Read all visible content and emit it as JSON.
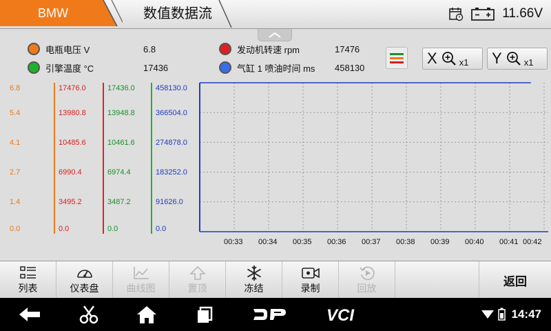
{
  "header": {
    "brand": "BMW",
    "title": "数值数据流",
    "voltage": "11.66V",
    "colors": {
      "brand_tab": "#f07a1a"
    }
  },
  "legend": [
    {
      "label": "电瓶电压  V",
      "value": "6.8",
      "color": "#f07a1a"
    },
    {
      "label": "引擎温度  °C",
      "value": "17436",
      "color": "#21b02a"
    },
    {
      "label": "发动机转速  rpm",
      "value": "17476",
      "color": "#e02020"
    },
    {
      "label": "气缸 1 喷油时间  ms",
      "value": "458130",
      "color": "#3a6de8"
    }
  ],
  "zoom": {
    "x_axis": "X",
    "y_axis": "Y",
    "x_level": "x1",
    "y_level": "x1"
  },
  "chart_data": {
    "type": "line",
    "x": [
      "00:33",
      "00:34",
      "00:35",
      "00:36",
      "00:37",
      "00:38",
      "00:39",
      "00:40",
      "00:41",
      "00:42"
    ],
    "y_axes": [
      {
        "series": "电瓶电压",
        "color": "#e87a1d",
        "ticks": [
          "6.8",
          "5.4",
          "4.1",
          "2.7",
          "1.4",
          "0.0"
        ]
      },
      {
        "series": "发动机转速",
        "color": "#d92020",
        "ticks": [
          "17476.0",
          "13980.8",
          "10485.6",
          "6990.4",
          "3495.2",
          "0.0"
        ]
      },
      {
        "series": "引擎温度",
        "color": "#1c8f2a",
        "ticks": [
          "17436.0",
          "13948.8",
          "10461.6",
          "6974.4",
          "3487.2",
          "0.0"
        ]
      },
      {
        "series": "气缸 1 喷油时间",
        "color": "#1f3cbf",
        "ticks": [
          "458130.0",
          "366504.0",
          "274878.0",
          "183252.0",
          "91626.0",
          "0.0"
        ]
      }
    ],
    "series": [
      {
        "name": "气缸 1 喷油时间",
        "color": "#1f3cbf",
        "values": [
          458130,
          458130,
          458130,
          458130,
          458130,
          458130,
          458130,
          458130,
          458130,
          458130
        ]
      }
    ],
    "grid": true
  },
  "toolbar": {
    "list": "列表",
    "dashboard": "仪表盘",
    "curve": "曲线图",
    "top": "置顶",
    "freeze": "冻结",
    "record": "录制",
    "playback": "回放",
    "back": "返回"
  },
  "navbar": {
    "dp": "DP",
    "vci": "VCI",
    "time": "14:47"
  }
}
